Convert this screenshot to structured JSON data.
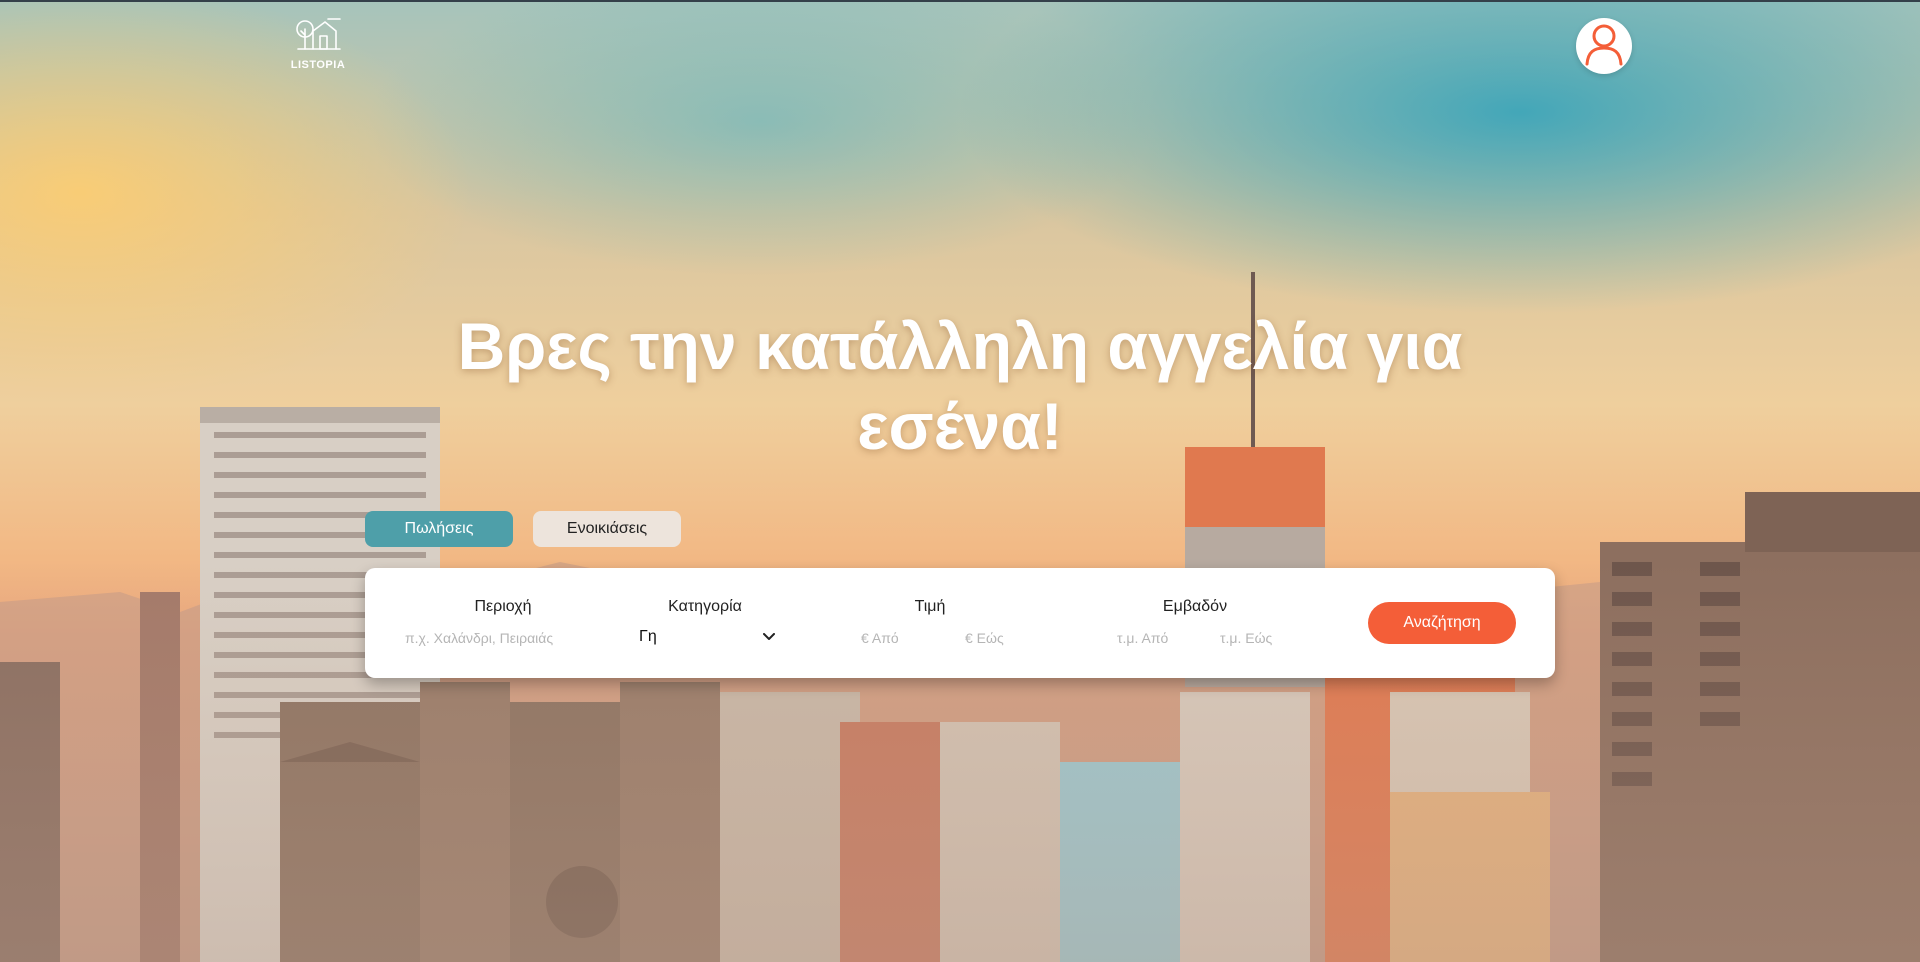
{
  "header": {
    "logo_text": "LISTOPIA"
  },
  "hero": {
    "headline": "Βρες την κατάλληλη αγγελία για εσένα!"
  },
  "tabs": [
    {
      "label": "Πωλήσεις",
      "active": true
    },
    {
      "label": "Ενοικιάσεις",
      "active": false
    }
  ],
  "search": {
    "area": {
      "label": "Περιοχή",
      "placeholder": "π.χ. Χαλάνδρι, Πειραιάς"
    },
    "category": {
      "label": "Κατηγορία",
      "value": "Γη"
    },
    "price": {
      "label": "Τιμή",
      "from_placeholder": "€ Από",
      "to_placeholder": "€ Εώς"
    },
    "surface": {
      "label": "Εμβαδόν",
      "from_placeholder": "τ.μ. Από",
      "to_placeholder": "τ.μ. Εώς"
    },
    "button_label": "Αναζήτηση"
  },
  "colors": {
    "accent_orange": "#f45e38",
    "tab_active": "#4e9fa9",
    "tab_inactive": "#ede4dc",
    "avatar_stroke": "#f45e38"
  },
  "icons": {
    "logo": "house-tree-logo-icon",
    "profile": "user-icon",
    "select": "chevron-down-icon"
  }
}
